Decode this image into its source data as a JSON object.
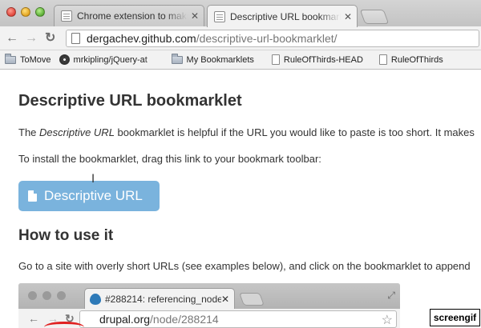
{
  "browser": {
    "tabs": [
      {
        "title": "Chrome extension to make a",
        "active": false
      },
      {
        "title": "Descriptive URL bookmarklet",
        "active": true
      }
    ],
    "address": {
      "host": "dergachev.github.com",
      "path": "/descriptive-url-bookmarklet/"
    },
    "bookmarks": [
      "ToMove",
      "mrkipling/jQuery-at",
      "My Bookmarklets",
      "RuleOfThirds-HEAD",
      "RuleOfThirds"
    ]
  },
  "page": {
    "title": "Descriptive URL bookmarklet",
    "intro_prefix": "The ",
    "intro_em": "Descriptive URL",
    "intro_rest": " bookmarklet is helpful if the URL you would like to paste is too short. It makes",
    "install_text": "To install the bookmarklet, drag this link to your bookmark toolbar:",
    "bookmarklet_label": "Descriptive URL",
    "howto_title": "How to use it",
    "howto_text": "Go to a site with overly short URLs (see examples below), and click on the bookmarklet to append"
  },
  "embedded": {
    "tab_title": "#288214: referencing_node",
    "url_host": "drupal.org",
    "url_path": "/node/288214"
  },
  "watermark": "screengif"
}
